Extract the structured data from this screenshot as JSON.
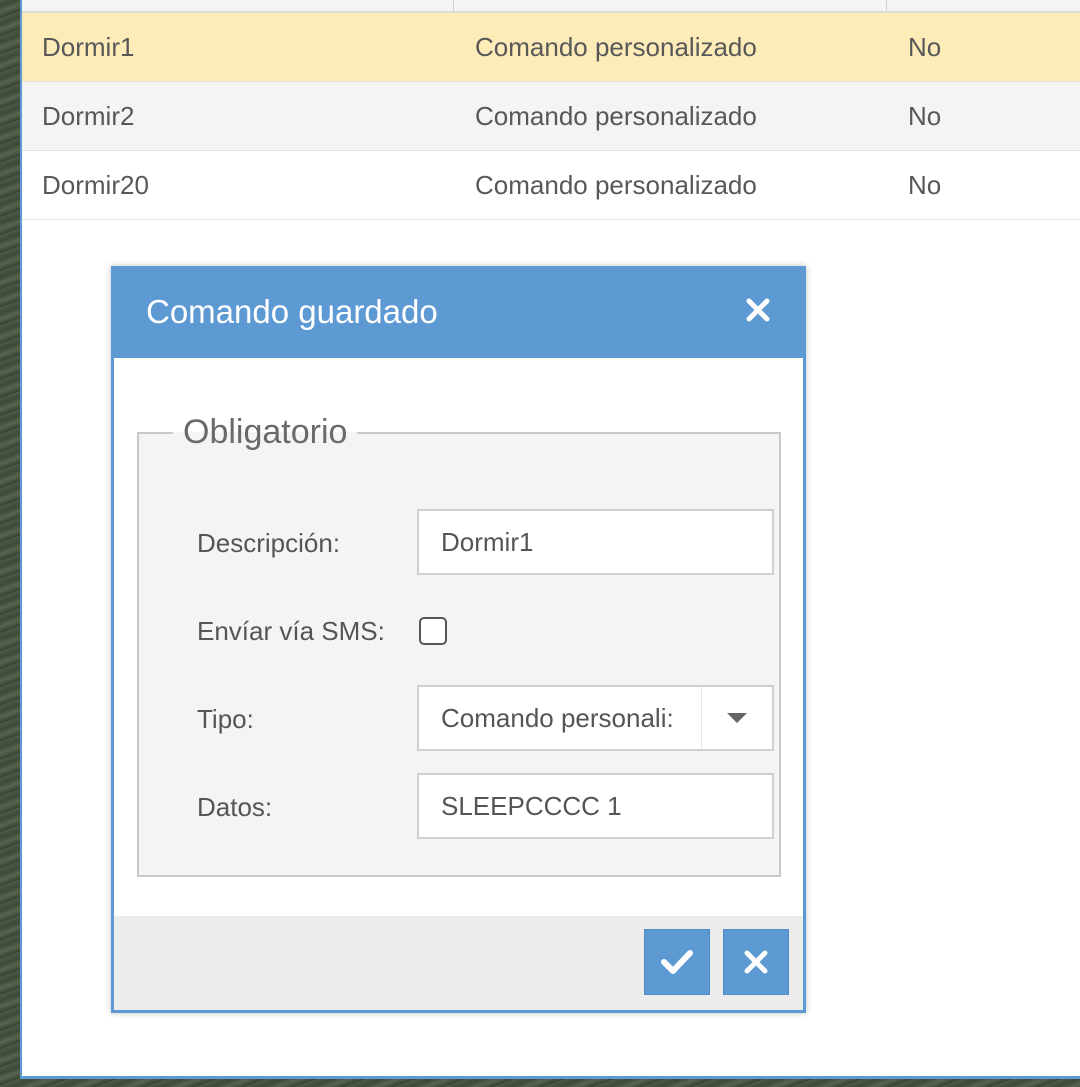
{
  "table": {
    "rows": [
      {
        "description": "Dormir1",
        "type": "Comando personalizado",
        "sms": "No",
        "selected": true
      },
      {
        "description": "Dormir2",
        "type": "Comando personalizado",
        "sms": "No",
        "selected": false
      },
      {
        "description": "Dormir20",
        "type": "Comando personalizado",
        "sms": "No",
        "selected": false
      }
    ]
  },
  "dialog": {
    "title": "Comando guardado",
    "close_icon": "close-icon",
    "group_legend": "Obligatorio",
    "fields": {
      "description_label": "Descripción:",
      "description_value": "Dormir1",
      "sms_label": "Envíar vía SMS:",
      "sms_checked": false,
      "type_label": "Tipo:",
      "type_value": "Comando personali:",
      "data_label": "Datos:",
      "data_value": "SLEEPCCCC 1"
    },
    "buttons": {
      "ok_icon": "check-icon",
      "cancel_icon": "close-icon"
    }
  },
  "colors": {
    "accent": "#5d9ad3",
    "selected_row": "#fdebb8"
  }
}
